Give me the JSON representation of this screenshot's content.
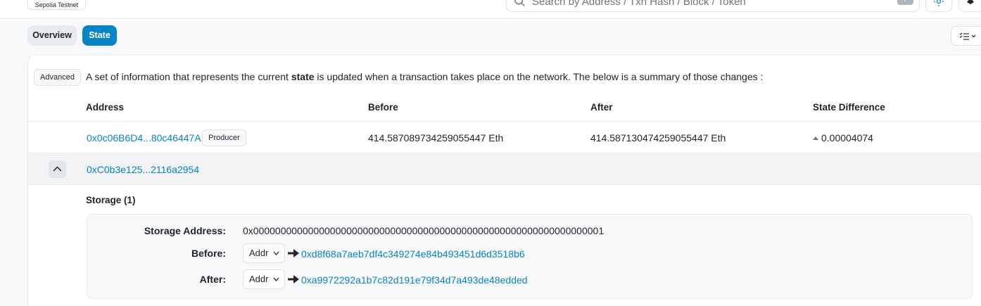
{
  "header": {
    "network_badge": "Sepolia Testnet",
    "search_placeholder": "Search by Address / Txn Hash / Block / Token",
    "search_shortcut": "/"
  },
  "tabs": [
    {
      "label": "Overview",
      "active": false
    },
    {
      "label": "State",
      "active": true
    }
  ],
  "state": {
    "advanced_badge": "Advanced",
    "description_pre": "A set of information that represents the current ",
    "description_bold": "state",
    "description_post": " is updated when a transaction takes place on the network. The below is a summary of those changes :",
    "columns": [
      "Address",
      "Before",
      "After",
      "State Difference"
    ],
    "rows": [
      {
        "address": "0x0c06B6D4...80c46447A",
        "badge": "Producer",
        "before": "414.587089734259055447 Eth",
        "after": "414.587130474259055447 Eth",
        "difference": "0.00004074"
      },
      {
        "address": "0xC0b3e125...2116a2954"
      }
    ],
    "storage": {
      "title": "Storage (1)",
      "address_label": "Storage Address:",
      "address_value": "0x0000000000000000000000000000000000000000000000000000000000000001",
      "before_label": "Before:",
      "before_format": "Addr",
      "before_value": "0xd8f68a7aeb7df4c349274e84b493451d6d3518b6",
      "after_label": "After:",
      "after_format": "Addr",
      "after_value": "0xa9972292a1b7c82d191e79f34d7a493de48edded"
    }
  },
  "colors": {
    "accent": "#0784c3",
    "link": "#0784c3"
  }
}
